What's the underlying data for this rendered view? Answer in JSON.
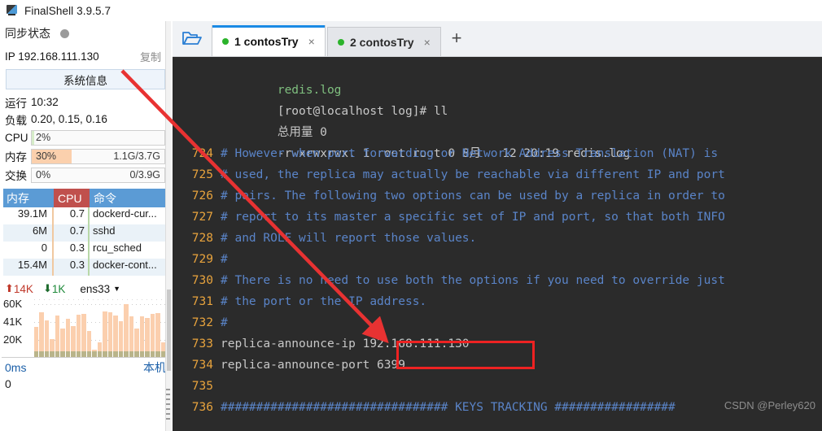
{
  "window": {
    "title": "FinalShell 3.9.5.7",
    "icon": "monitor-icon"
  },
  "sidebar": {
    "sync": {
      "label": "同步状态",
      "status_icon": "status-dot"
    },
    "ip": {
      "label": "IP 192.168.111.130",
      "copy_label": "复制"
    },
    "sysinfo_button": "系统信息",
    "uptime": {
      "key": "运行",
      "value": "10:32"
    },
    "load": {
      "key": "负载",
      "value": "0.20, 0.15, 0.16"
    },
    "meters": [
      {
        "label": "CPU",
        "percent": "2%",
        "percent_num": 2,
        "detail": "",
        "color": "#d6ecc8"
      },
      {
        "label": "内存",
        "percent": "30%",
        "percent_num": 30,
        "detail": "1.1G/3.7G",
        "color": "#fbd0ad"
      },
      {
        "label": "交换",
        "percent": "0%",
        "percent_num": 0,
        "detail": "0/3.9G",
        "color": "#cfe4f5"
      }
    ],
    "process_table": {
      "columns": [
        "内存",
        "CPU",
        "命令"
      ],
      "rows": [
        {
          "mem": "39.1M",
          "cpu": "0.7",
          "cmd": "dockerd-cur..."
        },
        {
          "mem": "6M",
          "cpu": "0.7",
          "cmd": "sshd"
        },
        {
          "mem": "0",
          "cpu": "0.3",
          "cmd": "rcu_sched"
        },
        {
          "mem": "15.4M",
          "cpu": "0.3",
          "cmd": "docker-cont..."
        }
      ]
    },
    "network": {
      "up_value": "14K",
      "down_value": "1K",
      "interface": "ens33",
      "y_ticks": [
        "60K",
        "41K",
        "20K"
      ],
      "bars": [
        52,
        78,
        63,
        31,
        72,
        49,
        66,
        54,
        73,
        74,
        45,
        13,
        26,
        79,
        77,
        72,
        62,
        92,
        70,
        50,
        70,
        68,
        74,
        76,
        25
      ]
    },
    "latency": {
      "value": "0ms",
      "host": "本机",
      "zero": "0"
    }
  },
  "tabbar": {
    "folder_icon": "folder-open-icon",
    "tabs": [
      {
        "label": "1 contosTry",
        "active": true,
        "status": "connected",
        "close": "×"
      },
      {
        "label": "2 contosTry",
        "active": false,
        "status": "connected",
        "close": "×"
      }
    ],
    "new_tab": "+"
  },
  "terminal": {
    "head_lines": [
      {
        "text": "redis.log",
        "color": "green"
      },
      {
        "text": "[root@localhost log]# ll",
        "color": "gray"
      },
      {
        "text": "总用量 0",
        "color": "gray"
      },
      {
        "text": "-rwxrwxrwx. 1 root root 0 8月   12 20:19 redis.log",
        "color": "gray"
      }
    ],
    "lines": [
      {
        "n": "724",
        "text": "# However when port forwarding or Network Address Translation (NAT) is",
        "color": "blue"
      },
      {
        "n": "725",
        "text": "# used, the replica may actually be reachable via different IP and port",
        "color": "blue"
      },
      {
        "n": "726",
        "text": "# pairs. The following two options can be used by a replica in order to",
        "color": "blue"
      },
      {
        "n": "727",
        "text": "# report to its master a specific set of IP and port, so that both INFO",
        "color": "blue"
      },
      {
        "n": "728",
        "text": "# and ROLE will report those values.",
        "color": "blue"
      },
      {
        "n": "729",
        "text": "#",
        "color": "blue"
      },
      {
        "n": "730",
        "text": "# There is no need to use both the options if you need to override just",
        "color": "blue"
      },
      {
        "n": "731",
        "text": "# the port or the IP address.",
        "color": "blue"
      },
      {
        "n": "732",
        "text": "#",
        "color": "blue"
      },
      {
        "n": "733",
        "text": "replica-announce-ip 192.168.111.130",
        "color": "gray"
      },
      {
        "n": "734",
        "text": "replica-announce-port 6399",
        "color": "gray"
      },
      {
        "n": "735",
        "text": "",
        "color": "gray"
      },
      {
        "n": "736",
        "text": "################################ KEYS TRACKING #################",
        "color": "blue"
      }
    ],
    "watermark": "CSDN @Perley620"
  },
  "annotations": {
    "highlight_color": "#ee2222",
    "arrow_color": "#e83232",
    "highlighted_value": "192.168.111.130"
  }
}
